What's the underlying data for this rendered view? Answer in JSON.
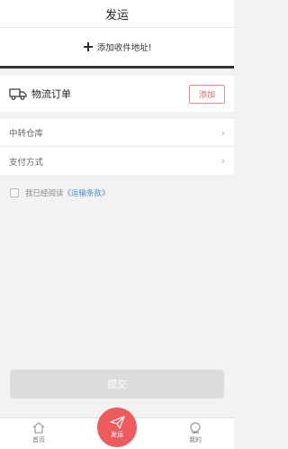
{
  "header": {
    "title": "发运"
  },
  "address": {
    "label": "添加收件地址!"
  },
  "logistics": {
    "title": "物流订单",
    "add_label": "添加"
  },
  "rows": [
    {
      "label": "中转仓库"
    },
    {
      "label": "支付方式"
    }
  ],
  "agreement": {
    "text": "我已经阅读",
    "link": "《运输条款》"
  },
  "submit_label": "提交",
  "tabbar": {
    "items": [
      {
        "label": "首页",
        "icon": "home-icon"
      },
      {
        "label": "发运",
        "icon": "send-icon"
      },
      {
        "label": "我的",
        "icon": "user-icon"
      }
    ]
  },
  "colors": {
    "accent": "#ec5b5e",
    "link": "#4a8fd6",
    "submit_disabled": "#dcdcdc"
  }
}
